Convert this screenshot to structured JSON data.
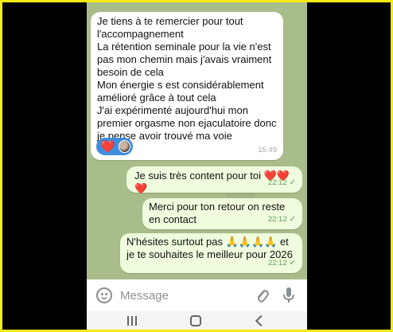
{
  "messages": [
    {
      "direction": "incoming",
      "text": "Je tiens à te remercier pour tout l'accompagnement\nLa rétention seminale pour la vie n'est pas mon chemin mais j'avais vraiment besoin de cela\nMon énergie s est considérablement amélioré grâce à tout cela\nJ'ai expérimenté aujourd'hui mon premier orgasme non ejaculatoire donc je pense avoir trouvé ma voie",
      "time": "15:49",
      "reaction": "❤️"
    },
    {
      "direction": "outgoing",
      "text": "Je suis très content pour toi ❤️❤️❤️",
      "time": "22:12",
      "status": "✓"
    },
    {
      "direction": "outgoing",
      "text": "Merci pour ton retour on reste en contact",
      "time": "22:12",
      "status": "✓"
    },
    {
      "direction": "outgoing",
      "text": "N'hésites surtout pas 🙏🙏🙏🙏 et je te souhaites le meilleur pour 2026",
      "time": "22:12",
      "status": "✓"
    }
  ],
  "input": {
    "placeholder": "Message"
  },
  "icons": {
    "emoji": "smiley-icon",
    "attach": "paperclip-icon",
    "mic": "microphone-icon",
    "nav_recent": "recent-apps-icon",
    "nav_home": "home-icon",
    "nav_back": "back-icon"
  },
  "colors": {
    "chat_background": "#a9bd8a",
    "incoming_bubble": "#ffffff",
    "outgoing_bubble": "#effdde",
    "reaction_pill": "#3f8ede",
    "frame_border": "#f7ea17"
  }
}
